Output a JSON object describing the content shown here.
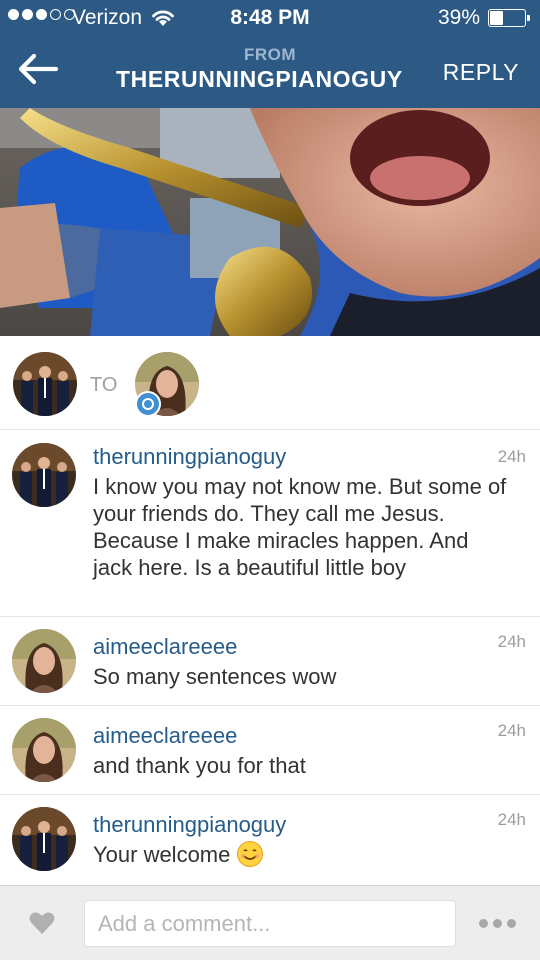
{
  "status_bar": {
    "carrier": "Verizon",
    "time": "8:48 PM",
    "battery_percent": "39%",
    "battery_level": 0.39,
    "signal_bars_filled": 3,
    "signal_bars_total": 5
  },
  "nav": {
    "from_label": "FROM",
    "title": "THERUNNINGPIANOGUY",
    "reply_label": "REPLY",
    "back_icon": "back-arrow-icon"
  },
  "recipients": {
    "to_label": "TO",
    "badge_icon": "viewed-icon"
  },
  "comments": [
    {
      "username": "therunningpianoguy",
      "time": "24h",
      "text": "I know you may not know me. But some of your friends do. They call me Jesus.  Because I make miracles happen.  And jack here.  Is a beautiful little boy",
      "avatar": "group"
    },
    {
      "username": "aimeeclareeee",
      "time": "24h",
      "text": "So many sentences wow",
      "avatar": "girl"
    },
    {
      "username": "aimeeclareeee",
      "time": "24h",
      "text": "and thank you for that",
      "avatar": "girl"
    },
    {
      "username": "therunningpianoguy",
      "time": "24h",
      "text": "Your welcome",
      "avatar": "group",
      "emoji": "smiling-face-emoji"
    }
  ],
  "footer": {
    "comment_placeholder": "Add a comment...",
    "like_icon": "heart-icon",
    "more_icon": "more-options-icon"
  },
  "colors": {
    "header_bg": "#2c5a85",
    "username": "#265c8a",
    "badge": "#3f8fd2"
  }
}
